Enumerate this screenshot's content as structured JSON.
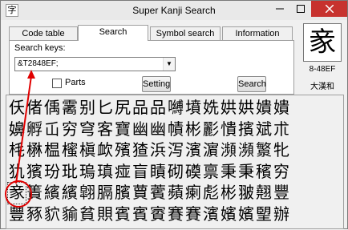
{
  "window": {
    "title": "Super Kanji Search",
    "icon_glyph": "字"
  },
  "tabs": [
    {
      "label": "Code table",
      "active": false
    },
    {
      "label": "Search",
      "active": true
    },
    {
      "label": "Symbol search",
      "active": false
    },
    {
      "label": "Information",
      "active": false
    }
  ],
  "search": {
    "label": "Search keys:",
    "value": "&T2848EF;",
    "parts_label": "Parts",
    "parts_checked": false,
    "setting_button": "Setting",
    "search_button": "Search"
  },
  "preview": {
    "glyph": "豙",
    "code": "8-48EF",
    "dictionary": "大漢和"
  },
  "results": [
    "仸偖偊霱别匕尻品品嚩墳姺娂娂嬇嬇",
    "嬶孵屲穷穹客寶幽幽幘彬彲憒擯斌朮",
    "枆楙榅櫁槇欰殯猹浜泻濱濵瀕瀕瀪牝",
    "犰獱玢玭瑦瑱痖盲瞔砌磸禀秉秉穦穷",
    "豙簀繽繽翶膈臏蕒薲蘋瘌彪彬翍翹豐",
    "豐豩貁貐貧賏賓賓賨賽賽濱嬪嬪朢辦"
  ],
  "colors": {
    "annotation": "#e00000",
    "close_button": "#c7322e"
  }
}
